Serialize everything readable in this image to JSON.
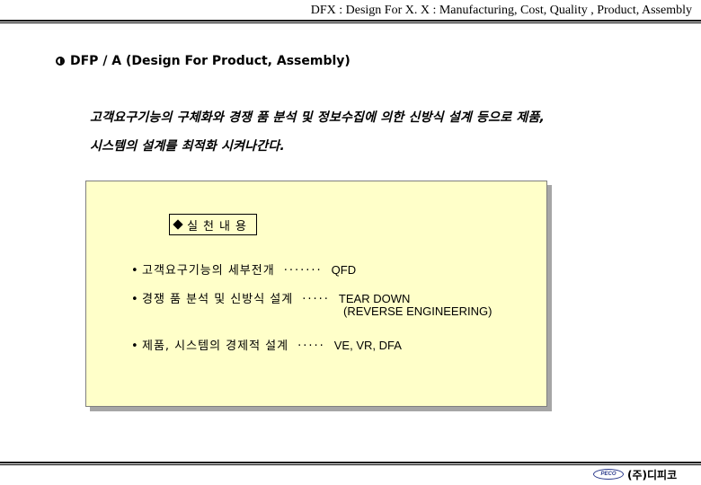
{
  "header": {
    "title": "DFX : Design For X. X : Manufacturing, Cost, Quality , Product, Assembly"
  },
  "section": {
    "heading": "DFP / A (Design For Product, Assembly)",
    "icon": "half-filled-circle-icon"
  },
  "intro": {
    "line1": "고객요구기능의 구체화와 경쟁 품 분석 및 정보수집에 의한 신방식 설계 등으로 제품,",
    "line2": "시스템의 설계를 최적화 시켜나간다."
  },
  "box": {
    "label": "실천내용",
    "label_icon": "diamond-icon",
    "background": "#ffffc9",
    "items": [
      {
        "bullet": "•",
        "text": "고객요구기능의 세부전개",
        "dots": "·······",
        "value": "QFD"
      },
      {
        "bullet": "•",
        "text": "경쟁 품 분석 및 신방식 설계",
        "dots": "·····",
        "value": "TEAR DOWN",
        "subvalue": "(REVERSE ENGINEERING)"
      },
      {
        "bullet": "•",
        "text": "제품, 시스템의 경제적 설계",
        "dots": "·····",
        "value": "VE, VR, DFA"
      }
    ]
  },
  "footer": {
    "logo_text": "PECO",
    "company": "(주)디피코"
  }
}
